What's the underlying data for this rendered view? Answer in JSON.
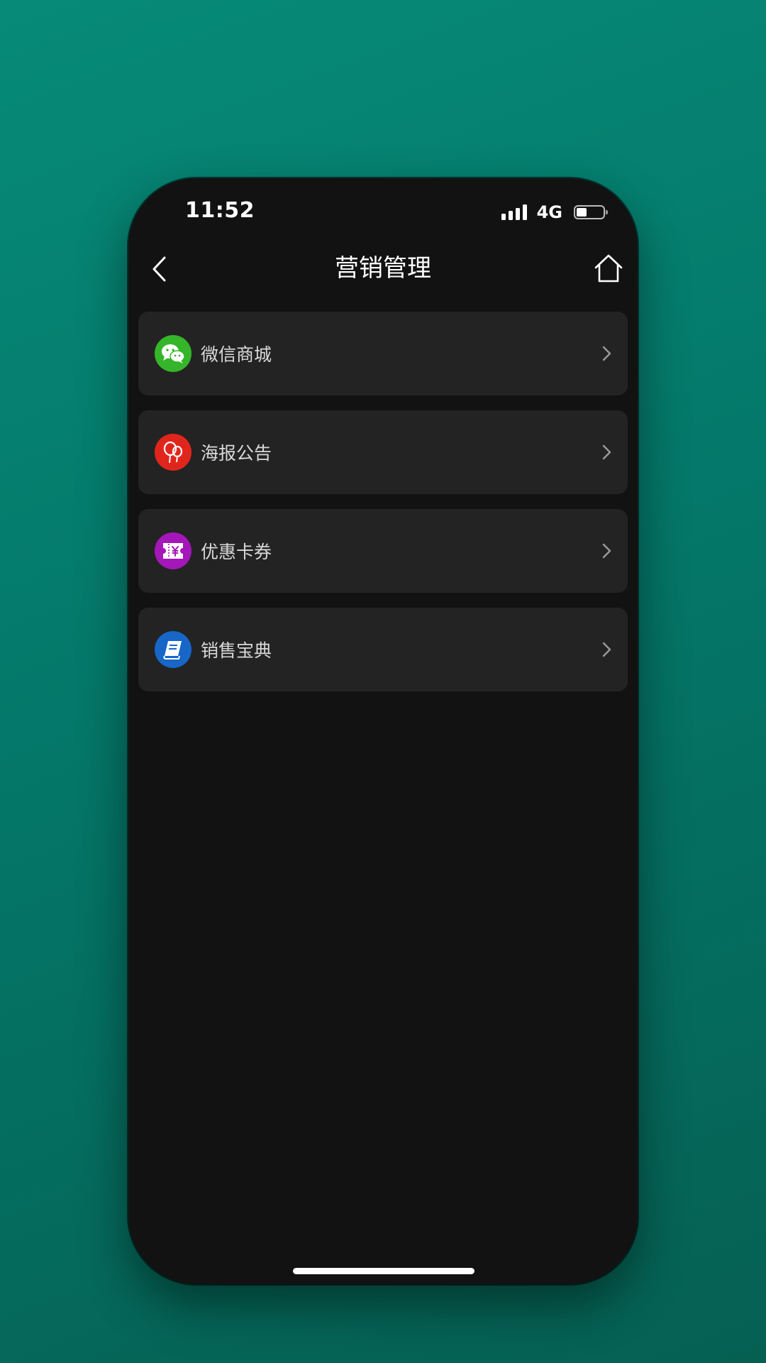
{
  "status_bar": {
    "time": "11:52",
    "network": "4G",
    "battery_level_percent": 40,
    "signal_bars": 4
  },
  "nav": {
    "title": "营销管理",
    "back_icon": "chevron-left-icon",
    "home_icon": "home-icon"
  },
  "menu": {
    "items": [
      {
        "label": "微信商城",
        "icon": "wechat-icon",
        "color": "#35b52a"
      },
      {
        "label": "海报公告",
        "icon": "balloon-icon",
        "color": "#e0261c"
      },
      {
        "label": "优惠卡券",
        "icon": "coupon-icon",
        "color": "#a417b8"
      },
      {
        "label": "销售宝典",
        "icon": "book-icon",
        "color": "#1766c8"
      }
    ]
  },
  "colors": {
    "background": "#06806f",
    "screen": "#121212",
    "card": "#232323",
    "text": "#d9d9d9"
  }
}
